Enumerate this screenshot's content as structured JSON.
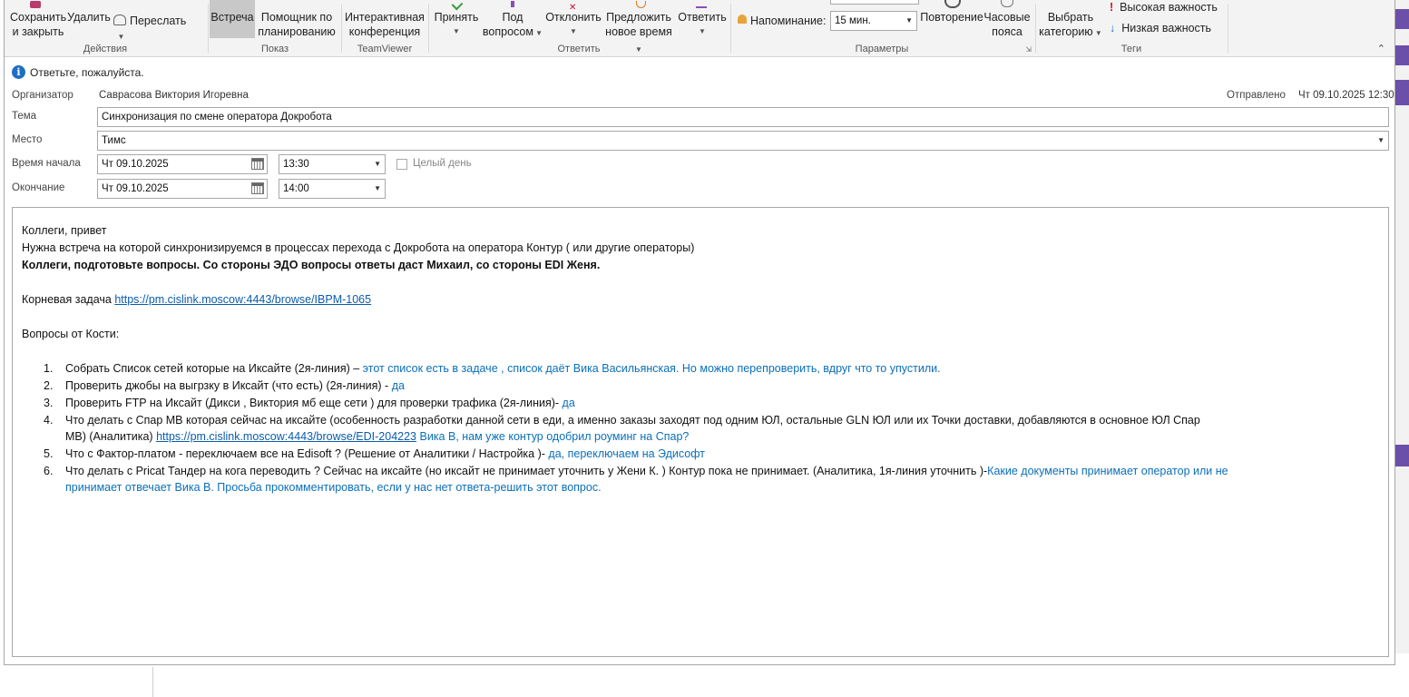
{
  "ribbon": {
    "actions": {
      "label": "Действия",
      "save_close_l1": "Сохранить",
      "save_close_l2": "и закрыть",
      "delete": "Удалить",
      "forward": "Переслать"
    },
    "show": {
      "label": "Показ",
      "meeting": "Встреча",
      "assistant_l1": "Помощник по",
      "assistant_l2": "планированию"
    },
    "teamviewer": {
      "label": "TeamViewer",
      "conf_l1": "Интерактивная",
      "conf_l2": "конференция"
    },
    "reply": {
      "label": "Ответить",
      "accept": "Принять",
      "tentative_l1": "Под",
      "tentative_l2": "вопросом",
      "decline": "Отклонить",
      "propose_l1": "Предложить",
      "propose_l2": "новое время",
      "respond": "Ответить"
    },
    "params": {
      "label": "Параметры",
      "reminder_label": "Напоминание:",
      "reminder_value": "15 мин.",
      "recurrence": "Повторение",
      "timezones_l1": "Часовые",
      "timezones_l2": "пояса"
    },
    "tags": {
      "label": "Теги",
      "category_l1": "Выбрать",
      "category_l2": "категорию",
      "high": "Высокая важность",
      "low": "Низкая важность"
    }
  },
  "info_text": "Ответьте, пожалуйста.",
  "meta": {
    "organizer_label": "Организатор",
    "organizer_value": "Саврасова Виктория Игоревна",
    "sent_label": "Отправлено",
    "sent_value": "Чт 09.10.2025 12:30",
    "subject_label": "Тема",
    "subject_value": "Синхронизация по смене оператора Докробота",
    "location_label": "Место",
    "location_value": "Тимс",
    "start_label": "Время начала",
    "start_date": "Чт 09.10.2025",
    "start_time": "13:30",
    "allday_label": "Целый день",
    "end_label": "Окончание",
    "end_date": "Чт 09.10.2025",
    "end_time": "14:00"
  },
  "body": {
    "greeting": "Коллеги, привет",
    "p1": "Нужна встреча на которой синхронизируемся  в процессах перехода с Докробота на оператора Контур ( или  другие операторы)",
    "p2_bold": "Коллеги, подготовьте вопросы. Со стороны ЭДО вопросы ответы даст Михаил, со стороны EDI Женя.",
    "root_task_label": "Корневая  задача ",
    "root_task_link": "https://pm.cislink.moscow:4443/browse/IBPM-1065",
    "questions_title": "Вопросы от Кости:",
    "items": [
      {
        "num": "1.",
        "text": "Собрать Список сетей которые на Иксайте  (2я-линия) – ",
        "answer": "этот список есть в задаче , список даёт Вика Васильянская. Но можно перепроверить, вдруг что то упустили."
      },
      {
        "num": "2.",
        "text": "Проверить джобы на выгрзку в Иксайт (что есть) (2я-линия) - ",
        "answer": "да"
      },
      {
        "num": "3.",
        "text": "Проверить FTP на Иксайт (Дикси , Виктория мб еще сети ) для проверки трафика (2я-линия)- ",
        "answer": "да"
      },
      {
        "num": "4.",
        "text": "Что делать с Спар МВ которая сейчас на иксайте (особенность разработки данной сети в еди, а именно заказы заходят под одним ЮЛ, остальные GLN ЮЛ или их Точки доставки, добавляются в основное ЮЛ Спар",
        "text2": "МВ)   (Аналитика) ",
        "link": "https://pm.cislink.moscow:4443/browse/EDI-204223",
        "answer": "  Вика В, нам уже контур одобрил роуминг на Спар?"
      },
      {
        "num": "5.",
        "text": "Что с Фактор-платом - переключаем все на Edisoft ? (Решение от Аналитики / Настройка )- ",
        "answer": "да, переключаем на Эдисофт"
      },
      {
        "num": "6.",
        "text": "Что делать с Pricat Тандер на кога переводить ? Сейчас на иксайте (но иксайт не принимает уточнить у Жени К. ) Контур пока не принимает. (Аналитика, 1я-линия уточнить )-",
        "answer": "Какие документы принимает оператор или не",
        "answer2": "принимает отвечает Вика В. Просьба прокомментировать, если у нас нет  ответа-решить этот вопрос."
      }
    ]
  },
  "colors": {
    "accent_blue": "#0b6fb8",
    "link": "#0b5cab",
    "ribbon_bg": "#f3f3f3",
    "high_importance": "#c8102e"
  }
}
